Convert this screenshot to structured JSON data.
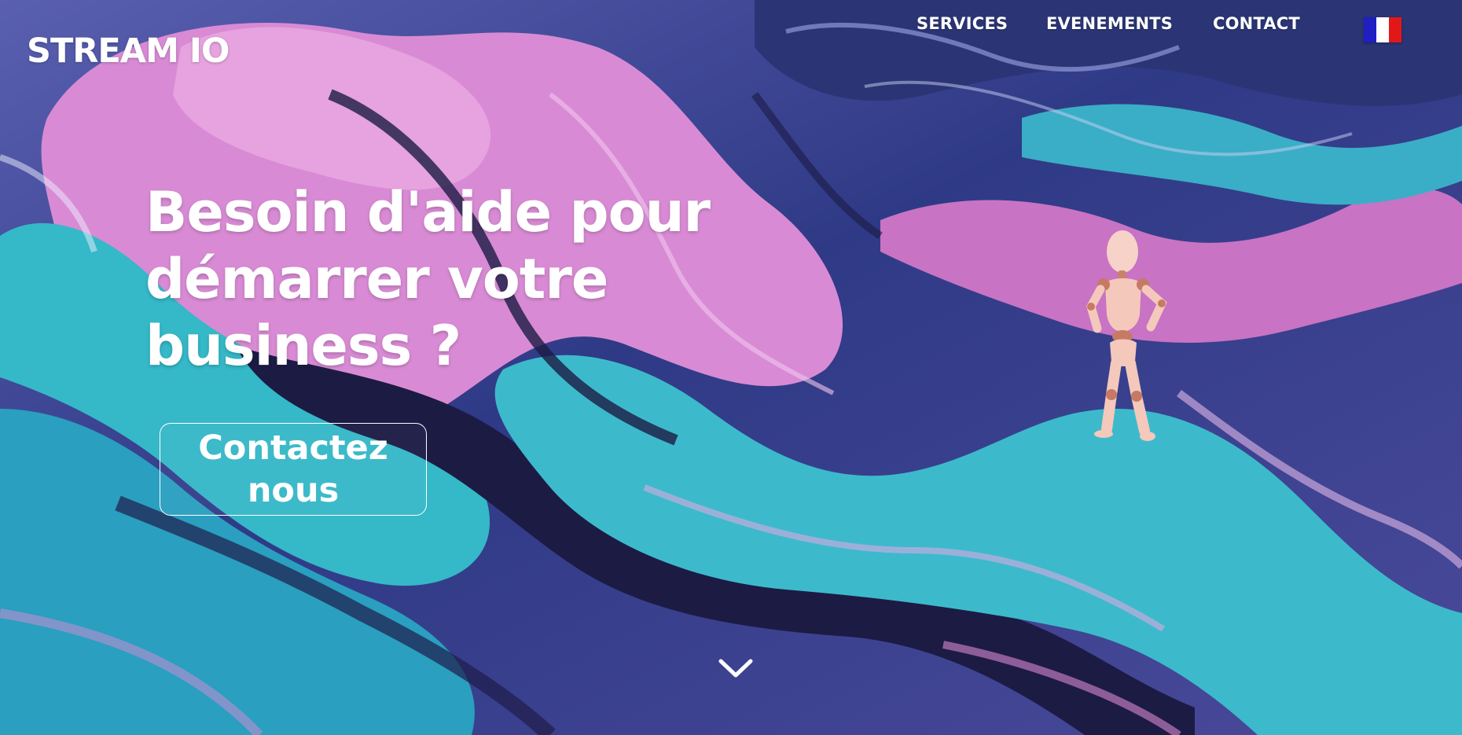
{
  "brand": {
    "logo_text": "STREAM IO"
  },
  "nav": {
    "items": [
      {
        "label": "SERVICES"
      },
      {
        "label": "EVENEMENTS"
      },
      {
        "label": "CONTACT"
      }
    ],
    "language_flag_icon": "france-flag-icon"
  },
  "hero": {
    "headline": "Besoin d'aide pour démarrer votre business ?",
    "cta_label": "Contactez nous",
    "scroll_icon": "chevron-down-icon",
    "figure_icon": "mannequin-figure"
  },
  "colors": {
    "text": "#ffffff",
    "background_pink": "#d98ad6",
    "background_teal": "#2fb4c8",
    "background_navy": "#23214f",
    "background_violet": "#6e6ab4"
  }
}
